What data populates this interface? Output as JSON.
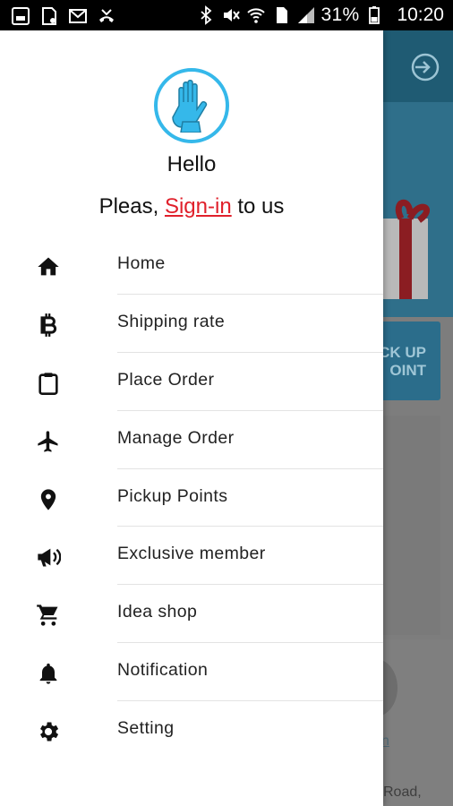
{
  "status_bar": {
    "battery": "31%",
    "time": "10:20"
  },
  "drawer": {
    "greeting": "Hello",
    "signin_prefix": "Pleas,",
    "signin_link": "Sign-in",
    "signin_suffix": "to us",
    "menu": [
      {
        "label": "Home",
        "icon": "home-icon"
      },
      {
        "label": "Shipping rate",
        "icon": "baht-icon"
      },
      {
        "label": "Place Order",
        "icon": "clipboard-icon"
      },
      {
        "label": "Manage Order",
        "icon": "airplane-icon"
      },
      {
        "label": "Pickup Points",
        "icon": "location-pin-icon"
      },
      {
        "label": "Exclusive member",
        "icon": "megaphone-icon"
      },
      {
        "label": "Idea shop",
        "icon": "cart-icon"
      },
      {
        "label": "Notification",
        "icon": "bell-icon"
      },
      {
        "label": "Setting",
        "icon": "gear-icon"
      }
    ]
  },
  "background_app": {
    "card_text_line1": "CK UP",
    "card_text_line2": "OINT",
    "link_fragment": "n",
    "address_fragment": "Road,"
  },
  "colors": {
    "accent_blue": "#35b8ea",
    "signin_red": "#e0202b",
    "toolbar": "#1f5b73"
  }
}
